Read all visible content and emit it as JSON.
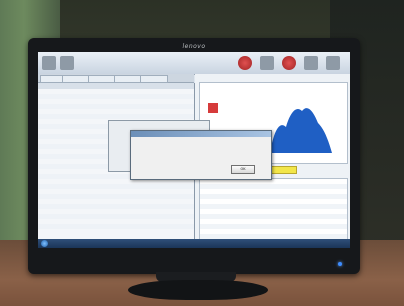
{
  "monitor": {
    "brand": "lenovo",
    "power_led_color": "#3d8cff"
  },
  "app": {
    "toolbar_colors": {
      "primary": "#e05050",
      "secondary": "#8e9aa6"
    },
    "tabs": [
      "",
      "",
      "",
      "",
      ""
    ],
    "list_rows": [
      "",
      "",
      "",
      "",
      "",
      "",
      "",
      "",
      "",
      "",
      "",
      "",
      "",
      "",
      "",
      "",
      "",
      "",
      "",
      "",
      "",
      "",
      "",
      "",
      "",
      "",
      "",
      "",
      ""
    ],
    "chart": {
      "series_color": "#1f5fc4",
      "marker_color": "#d63b3b",
      "indicator_color": "#f2e64a"
    },
    "data_rows": [
      "",
      "",
      "",
      "",
      "",
      "",
      "",
      "",
      "",
      "",
      "",
      ""
    ]
  },
  "dialog": {
    "title": "",
    "message": "",
    "ok_label": "OK"
  }
}
